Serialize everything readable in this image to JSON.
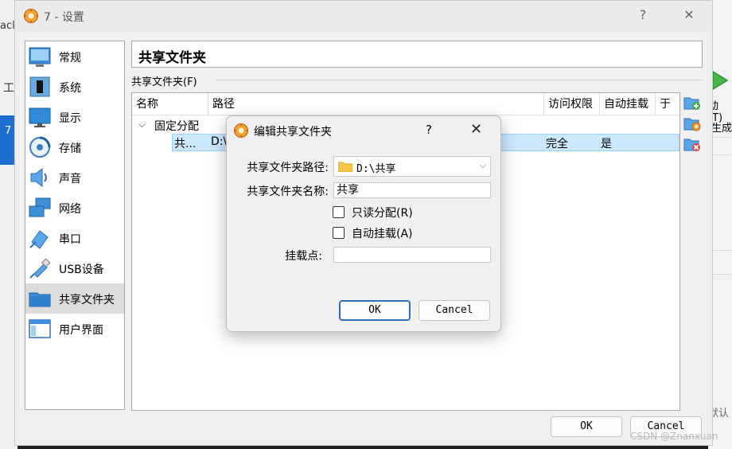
{
  "background": {
    "left_text_top": "acle",
    "left_text_mid": "工",
    "left_selected_label": "7",
    "right_label_1": "动(T)",
    "right_label_2": "生成",
    "right_label_3": "默认"
  },
  "window": {
    "title": "7 - 设置",
    "help": "?",
    "close": "✕"
  },
  "nav": {
    "items": [
      {
        "label": "常规",
        "icon": "general-icon"
      },
      {
        "label": "系统",
        "icon": "system-chip-icon"
      },
      {
        "label": "显示",
        "icon": "display-monitor-icon"
      },
      {
        "label": "存储",
        "icon": "storage-disk-icon"
      },
      {
        "label": "声音",
        "icon": "audio-speaker-icon"
      },
      {
        "label": "网络",
        "icon": "network-icon"
      },
      {
        "label": "串口",
        "icon": "serial-port-icon"
      },
      {
        "label": "USB设备",
        "icon": "usb-icon"
      },
      {
        "label": "共享文件夹",
        "icon": "shared-folder-icon"
      },
      {
        "label": "用户界面",
        "icon": "user-interface-icon"
      }
    ],
    "active_index": 8
  },
  "page": {
    "title": "共享文件夹",
    "group_label": "共享文件夹(F)"
  },
  "table": {
    "headers": [
      "名称",
      "路径",
      "访问权限",
      "自动挂载",
      "于"
    ],
    "group": "固定分配",
    "row": {
      "name": "共...",
      "path": "D:\\",
      "access": "完全",
      "automount": "是"
    }
  },
  "window_buttons": {
    "ok": "OK",
    "cancel": "Cancel"
  },
  "dialog": {
    "title": "编辑共享文件夹",
    "help": "?",
    "close": "✕",
    "path_label": "共享文件夹路径:",
    "path_value": "D:\\共享",
    "name_label": "共享文件夹名称:",
    "name_value": "共享",
    "readonly_label": "只读分配(R)",
    "readonly_checked": false,
    "automount_label": "自动挂载(A)",
    "automount_checked": false,
    "mountpoint_label": "挂载点:",
    "mountpoint_value": "",
    "ok": "OK",
    "cancel": "Cancel"
  },
  "watermark": "CSDN @Znanxuan",
  "colors": {
    "selection": "#cce8ff",
    "accent": "#2d6fbd",
    "window_bg": "#f0f0f0"
  }
}
